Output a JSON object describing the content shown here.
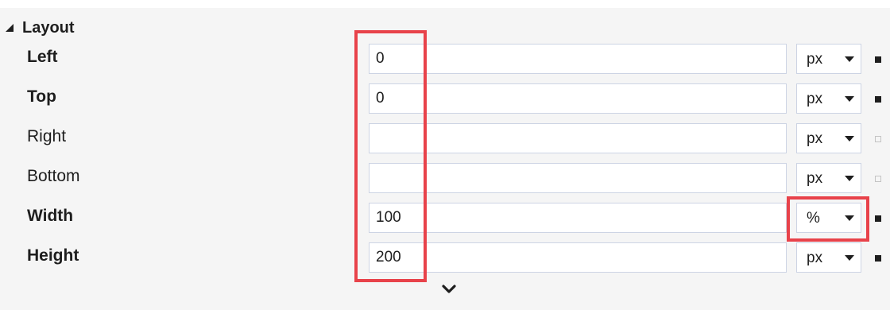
{
  "section": {
    "title": "Layout",
    "collapse_icon": "triangle-down-icon"
  },
  "properties": [
    {
      "label": "Left",
      "value": "0",
      "unit": "px",
      "bold": true,
      "set": true
    },
    {
      "label": "Top",
      "value": "0",
      "unit": "px",
      "bold": true,
      "set": true
    },
    {
      "label": "Right",
      "value": "",
      "unit": "px",
      "bold": false,
      "set": false
    },
    {
      "label": "Bottom",
      "value": "",
      "unit": "px",
      "bold": false,
      "set": false
    },
    {
      "label": "Width",
      "value": "100",
      "unit": "%",
      "bold": true,
      "set": true
    },
    {
      "label": "Height",
      "value": "200",
      "unit": "px",
      "bold": true,
      "set": true
    }
  ],
  "expand_icon": "chevron-down-icon",
  "colors": {
    "highlight": "#e8424a",
    "panel_background": "#f5f5f5",
    "input_border": "#cdd4e4",
    "text": "#1e1e1e"
  }
}
